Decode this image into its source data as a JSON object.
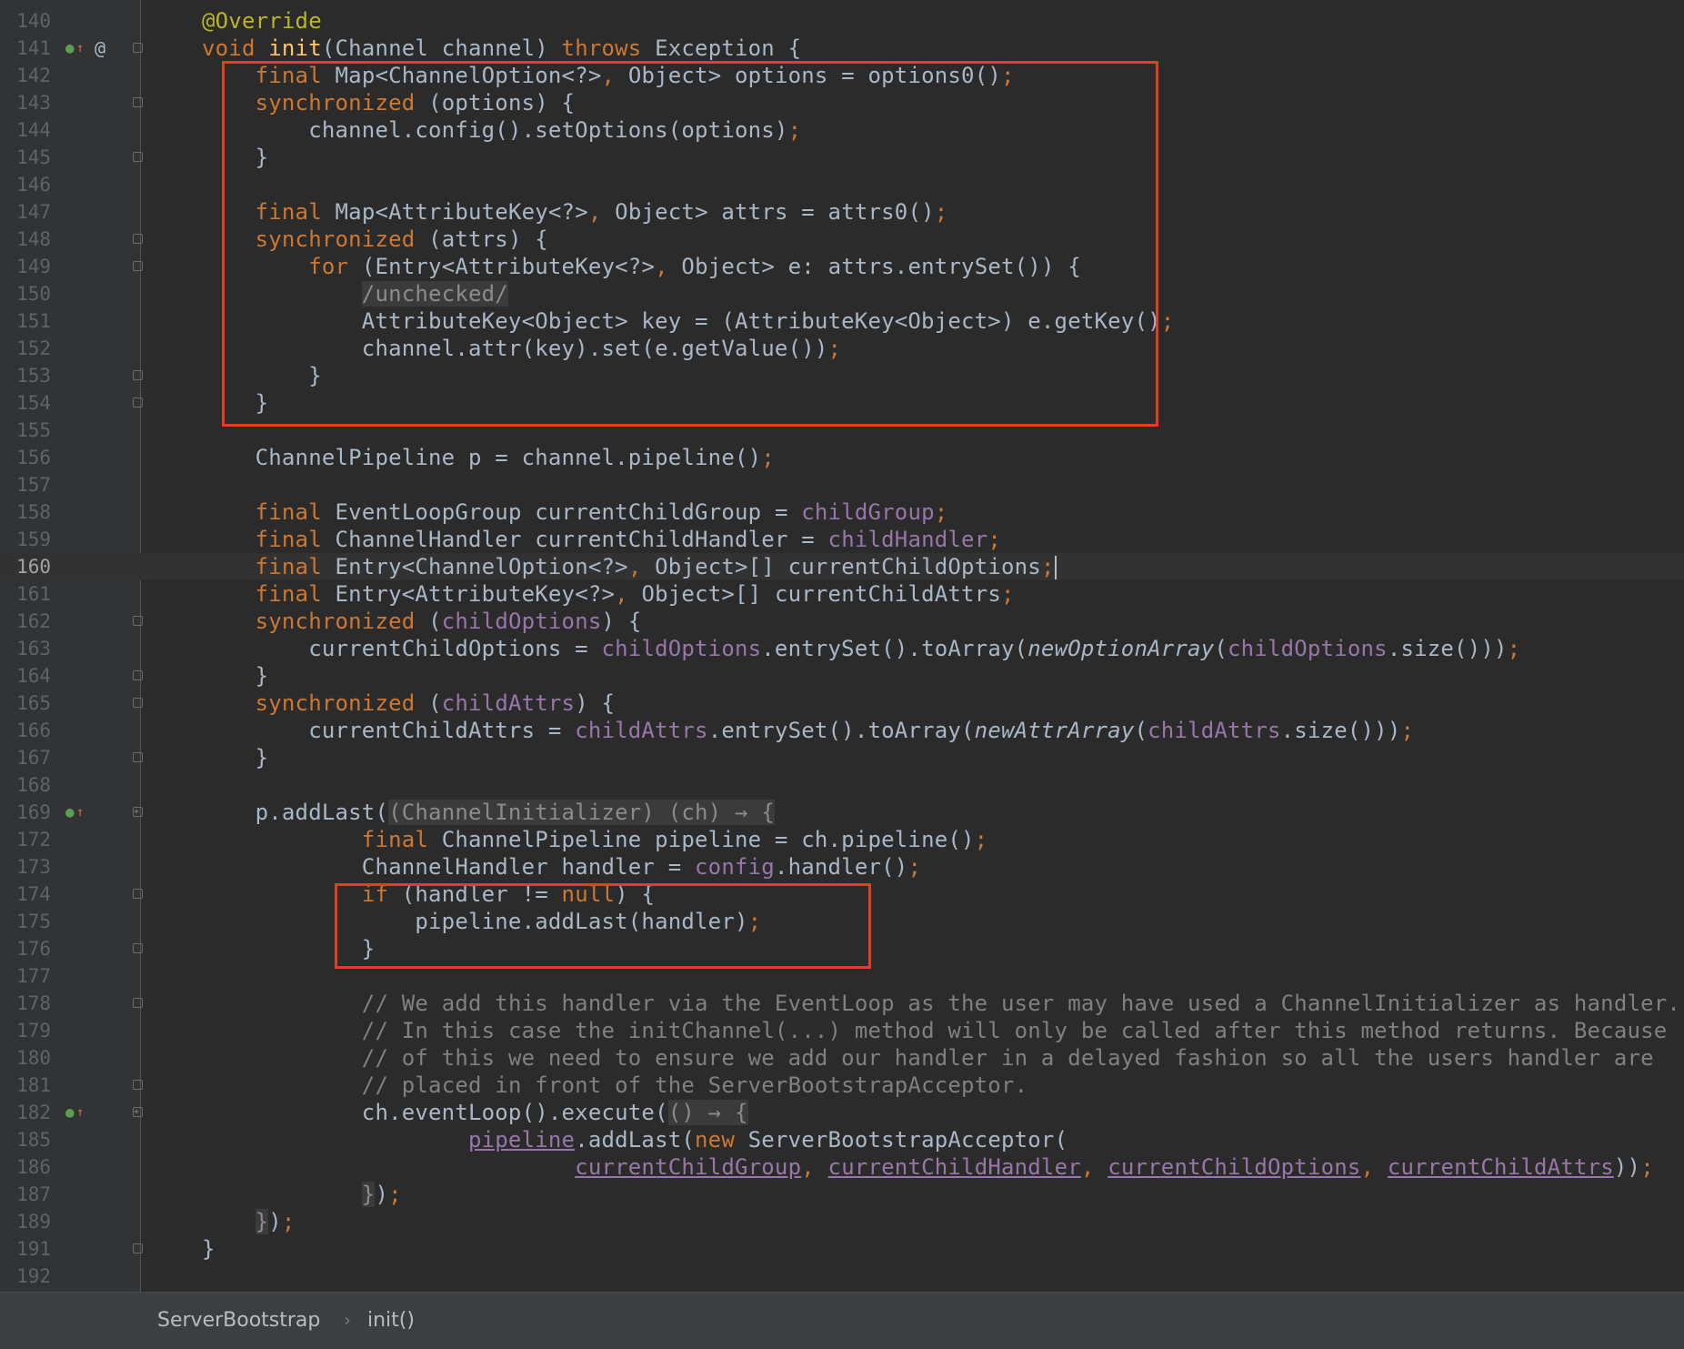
{
  "editor": {
    "lines": [
      {
        "num": "140",
        "tokens": [
          [
            "ann",
            "@Override"
          ]
        ]
      },
      {
        "num": "141",
        "gutter": [
          "override",
          "at"
        ],
        "fold": "minus",
        "tokens": [
          [
            "kw",
            "void "
          ],
          [
            "fn",
            "init"
          ],
          [
            "",
            "(Channel channel) "
          ],
          [
            "kw",
            "throws "
          ],
          [
            "",
            "Exception {"
          ]
        ]
      },
      {
        "num": "142",
        "tokens": [
          [
            "",
            "    "
          ],
          [
            "kw",
            "final "
          ],
          [
            "",
            "Map<ChannelOption<?>"
          ],
          [
            "kw",
            ", "
          ],
          [
            "",
            "Object> options = options0()"
          ],
          [
            "kw",
            ";"
          ]
        ]
      },
      {
        "num": "143",
        "fold": "minus",
        "tokens": [
          [
            "",
            "    "
          ],
          [
            "kw",
            "synchronized "
          ],
          [
            "",
            "(options) {"
          ]
        ]
      },
      {
        "num": "144",
        "tokens": [
          [
            "",
            "        channel.config().setOptions(options)"
          ],
          [
            "kw",
            ";"
          ]
        ]
      },
      {
        "num": "145",
        "fold": "minus",
        "tokens": [
          [
            "",
            "    }"
          ]
        ]
      },
      {
        "num": "146",
        "tokens": []
      },
      {
        "num": "147",
        "tokens": [
          [
            "",
            "    "
          ],
          [
            "kw",
            "final "
          ],
          [
            "",
            "Map<AttributeKey<?>"
          ],
          [
            "kw",
            ", "
          ],
          [
            "",
            "Object> attrs = attrs0()"
          ],
          [
            "kw",
            ";"
          ]
        ]
      },
      {
        "num": "148",
        "fold": "minus",
        "tokens": [
          [
            "",
            "    "
          ],
          [
            "kw",
            "synchronized "
          ],
          [
            "",
            "(attrs) {"
          ]
        ]
      },
      {
        "num": "149",
        "fold": "minus",
        "tokens": [
          [
            "",
            "        "
          ],
          [
            "kw",
            "for "
          ],
          [
            "",
            "(Entry<AttributeKey<?>"
          ],
          [
            "kw",
            ", "
          ],
          [
            "",
            "Object> e: attrs.entrySet()) {"
          ]
        ]
      },
      {
        "num": "150",
        "tokens": [
          [
            "",
            "            "
          ],
          [
            "fold-ph",
            "/unchecked/"
          ]
        ]
      },
      {
        "num": "151",
        "tokens": [
          [
            "",
            "            AttributeKey<Object> key = (AttributeKey<Object>) e.getKey()"
          ],
          [
            "kw",
            ";"
          ]
        ]
      },
      {
        "num": "152",
        "tokens": [
          [
            "",
            "            channel.attr(key).set(e.getValue())"
          ],
          [
            "kw",
            ";"
          ]
        ]
      },
      {
        "num": "153",
        "fold": "minus",
        "tokens": [
          [
            "",
            "        }"
          ]
        ]
      },
      {
        "num": "154",
        "fold": "minus",
        "tokens": [
          [
            "",
            "    }"
          ]
        ]
      },
      {
        "num": "155",
        "tokens": []
      },
      {
        "num": "156",
        "tokens": [
          [
            "",
            "    ChannelPipeline p = channel.pipeline()"
          ],
          [
            "kw",
            ";"
          ]
        ]
      },
      {
        "num": "157",
        "tokens": []
      },
      {
        "num": "158",
        "tokens": [
          [
            "",
            "    "
          ],
          [
            "kw",
            "final "
          ],
          [
            "",
            "EventLoopGroup currentChildGroup = "
          ],
          [
            "fld",
            "childGroup"
          ],
          [
            "kw",
            ";"
          ]
        ]
      },
      {
        "num": "159",
        "tokens": [
          [
            "",
            "    "
          ],
          [
            "kw",
            "final "
          ],
          [
            "",
            "ChannelHandler currentChildHandler = "
          ],
          [
            "fld",
            "childHandler"
          ],
          [
            "kw",
            ";"
          ]
        ]
      },
      {
        "num": "160",
        "current": true,
        "tokens": [
          [
            "",
            "    "
          ],
          [
            "kw",
            "final "
          ],
          [
            "",
            "Entry<ChannelOption<?>"
          ],
          [
            "kw",
            ", "
          ],
          [
            "",
            "Object>[] currentChildOptions"
          ],
          [
            "kw",
            ";"
          ],
          [
            "caret",
            ""
          ]
        ]
      },
      {
        "num": "161",
        "tokens": [
          [
            "",
            "    "
          ],
          [
            "kw",
            "final "
          ],
          [
            "",
            "Entry<AttributeKey<?>"
          ],
          [
            "kw",
            ", "
          ],
          [
            "",
            "Object>[] currentChildAttrs"
          ],
          [
            "kw",
            ";"
          ]
        ]
      },
      {
        "num": "162",
        "fold": "minus",
        "tokens": [
          [
            "",
            "    "
          ],
          [
            "kw",
            "synchronized "
          ],
          [
            "",
            "("
          ],
          [
            "fld",
            "childOptions"
          ],
          [
            "",
            ") {"
          ]
        ]
      },
      {
        "num": "163",
        "tokens": [
          [
            "",
            "        currentChildOptions = "
          ],
          [
            "fld",
            "childOptions"
          ],
          [
            "",
            ".entrySet().toArray("
          ],
          [
            "it",
            "newOptionArray"
          ],
          [
            "",
            "("
          ],
          [
            "fld",
            "childOptions"
          ],
          [
            "",
            ".size()))"
          ],
          [
            "kw",
            ";"
          ]
        ]
      },
      {
        "num": "164",
        "fold": "minus",
        "tokens": [
          [
            "",
            "    }"
          ]
        ]
      },
      {
        "num": "165",
        "fold": "minus",
        "tokens": [
          [
            "",
            "    "
          ],
          [
            "kw",
            "synchronized "
          ],
          [
            "",
            "("
          ],
          [
            "fld",
            "childAttrs"
          ],
          [
            "",
            ") {"
          ]
        ]
      },
      {
        "num": "166",
        "tokens": [
          [
            "",
            "        currentChildAttrs = "
          ],
          [
            "fld",
            "childAttrs"
          ],
          [
            "",
            ".entrySet().toArray("
          ],
          [
            "it",
            "newAttrArray"
          ],
          [
            "",
            "("
          ],
          [
            "fld",
            "childAttrs"
          ],
          [
            "",
            ".size()))"
          ],
          [
            "kw",
            ";"
          ]
        ]
      },
      {
        "num": "167",
        "fold": "minus",
        "tokens": [
          [
            "",
            "    }"
          ]
        ]
      },
      {
        "num": "168",
        "tokens": []
      },
      {
        "num": "169",
        "gutter": [
          "override"
        ],
        "fold": "plus",
        "tokens": [
          [
            "",
            "    p.addLast("
          ],
          [
            "fold-ph",
            "(ChannelInitializer) (ch) → {"
          ]
        ]
      },
      {
        "num": "172",
        "tokens": [
          [
            "",
            "            "
          ],
          [
            "kw",
            "final "
          ],
          [
            "",
            "ChannelPipeline pipeline = ch.pipeline()"
          ],
          [
            "kw",
            ";"
          ]
        ]
      },
      {
        "num": "173",
        "tokens": [
          [
            "",
            "            ChannelHandler handler = "
          ],
          [
            "fld",
            "config"
          ],
          [
            "",
            ".handler()"
          ],
          [
            "kw",
            ";"
          ]
        ]
      },
      {
        "num": "174",
        "fold": "minus",
        "tokens": [
          [
            "",
            "            "
          ],
          [
            "kw",
            "if "
          ],
          [
            "",
            "(handler != "
          ],
          [
            "kw",
            "null"
          ],
          [
            "",
            ") {"
          ]
        ]
      },
      {
        "num": "175",
        "tokens": [
          [
            "",
            "                pipeline.addLast(handler)"
          ],
          [
            "kw",
            ";"
          ]
        ]
      },
      {
        "num": "176",
        "fold": "minus",
        "tokens": [
          [
            "",
            "            }"
          ]
        ]
      },
      {
        "num": "177",
        "tokens": []
      },
      {
        "num": "178",
        "fold": "minus",
        "tokens": [
          [
            "",
            "            "
          ],
          [
            "com",
            "// We add this handler via the EventLoop as the user may have used a ChannelInitializer as handler."
          ]
        ]
      },
      {
        "num": "179",
        "tokens": [
          [
            "",
            "            "
          ],
          [
            "com",
            "// In this case the initChannel(...) method will only be called after this method returns. Because"
          ]
        ]
      },
      {
        "num": "180",
        "tokens": [
          [
            "",
            "            "
          ],
          [
            "com",
            "// of this we need to ensure we add our handler in a delayed fashion so all the users handler are"
          ]
        ]
      },
      {
        "num": "181",
        "fold": "minus",
        "tokens": [
          [
            "",
            "            "
          ],
          [
            "com",
            "// placed in front of the ServerBootstrapAcceptor."
          ]
        ]
      },
      {
        "num": "182",
        "gutter": [
          "override"
        ],
        "fold": "plus",
        "tokens": [
          [
            "",
            "            ch.eventLoop().execute("
          ],
          [
            "fold-ph",
            "() → {"
          ]
        ]
      },
      {
        "num": "185",
        "tokens": [
          [
            "",
            "                    "
          ],
          [
            "fld ul",
            "pipeline"
          ],
          [
            "",
            ".addLast("
          ],
          [
            "kw",
            "new "
          ],
          [
            "",
            "ServerBootstrapAcceptor("
          ]
        ]
      },
      {
        "num": "186",
        "tokens": [
          [
            "",
            "                            "
          ],
          [
            "fld ul",
            "currentChildGroup"
          ],
          [
            "kw",
            ", "
          ],
          [
            "fld ul",
            "currentChildHandler"
          ],
          [
            "kw",
            ", "
          ],
          [
            "fld ul",
            "currentChildOptions"
          ],
          [
            "kw",
            ", "
          ],
          [
            "fld ul",
            "currentChildAttrs"
          ],
          [
            "",
            "))"
          ],
          [
            "kw",
            ";"
          ]
        ]
      },
      {
        "num": "187",
        "tokens": [
          [
            "",
            "            "
          ],
          [
            "fold-ph",
            "}"
          ],
          [
            "",
            ")"
          ],
          [
            "kw",
            ";"
          ]
        ]
      },
      {
        "num": "189",
        "tokens": [
          [
            "",
            "    "
          ],
          [
            "fold-ph",
            "}"
          ],
          [
            "",
            ")"
          ],
          [
            "kw",
            ";"
          ]
        ]
      },
      {
        "num": "191",
        "fold": "minus",
        "tokens": [
          [
            "",
            "}"
          ]
        ]
      },
      {
        "num": "192",
        "tokens": []
      }
    ]
  },
  "breadcrumb": {
    "class_name": "ServerBootstrap",
    "separator": "›",
    "method_name": "init()"
  },
  "colors": {
    "keyword": "#cc7832",
    "annotation": "#bbb529",
    "method": "#ffc66d",
    "field": "#9876aa",
    "comment": "#808080",
    "highlight_box": "#e03f25"
  }
}
